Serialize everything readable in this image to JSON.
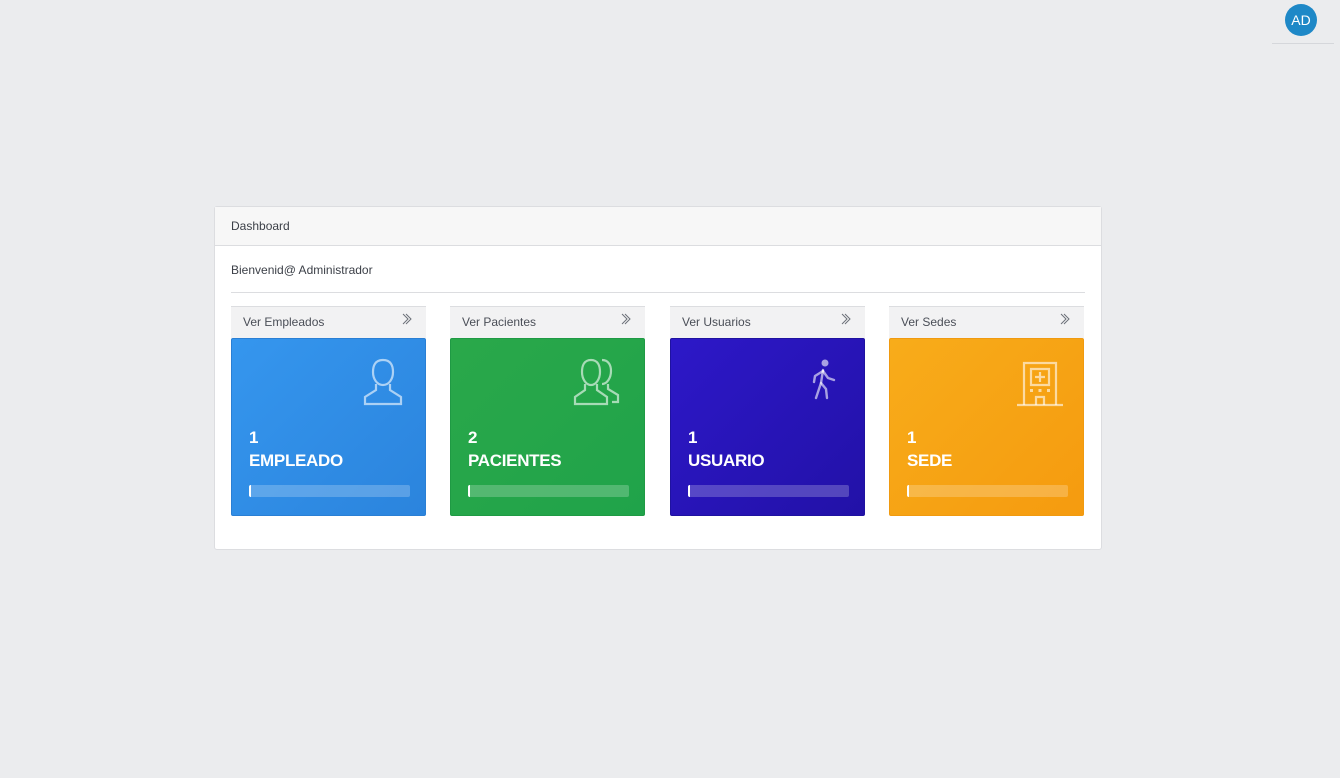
{
  "user": {
    "avatar_initials": "AD"
  },
  "panel": {
    "title": "Dashboard",
    "welcome": "Bienvenid@ Administrador"
  },
  "cards": [
    {
      "link_label": "Ver Empleados",
      "count": "1",
      "label": "EMPLEADO",
      "icon": "user-icon",
      "color": "#3596ee",
      "progress": 0.01
    },
    {
      "link_label": "Ver Pacientes",
      "count": "2",
      "label": "PACIENTES",
      "icon": "users-icon",
      "color": "#2aa84a",
      "progress": 0.01
    },
    {
      "link_label": "Ver Usuarios",
      "count": "1",
      "label": "USUARIO",
      "icon": "walking-person-icon",
      "color": "#2d18c8",
      "progress": 0.01
    },
    {
      "link_label": "Ver Sedes",
      "count": "1",
      "label": "SEDE",
      "icon": "hospital-icon",
      "color": "#f8ac1a",
      "progress": 0.01
    }
  ]
}
